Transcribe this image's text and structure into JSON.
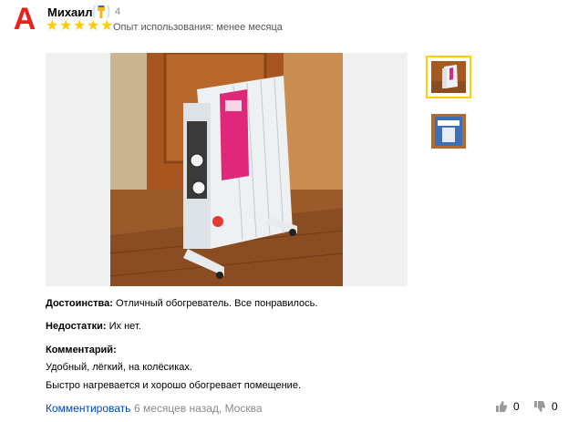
{
  "author": {
    "avatar_letter": "A",
    "name": "Михаил",
    "badge_count": "4",
    "rating_stars": 5,
    "experience": "Опыт использования: менее месяца"
  },
  "review": {
    "pros_label": "Достоинства:",
    "pros_text": "Отличный обогреватель. Все понравилось.",
    "cons_label": "Недостатки:",
    "cons_text": "Их нет.",
    "comment_label": "Комментарий:",
    "comment_line1": "Удобный, лёгкий, на колёсиках.",
    "comment_line2": "Быстро нагревается и хорошо обогревает помещение."
  },
  "footer": {
    "comment_link": "Комментировать",
    "date_location": "6 месяцев назад, Москва",
    "likes": "0",
    "dislikes": "0"
  },
  "colors": {
    "star": "#ffcc00",
    "avatar_letter": "#e8221b",
    "link": "#0044bb",
    "thumb_selected_border": "#ffcc00"
  },
  "icons": [
    "badge-icon",
    "star-icon",
    "thumbs-up-icon",
    "thumbs-down-icon"
  ]
}
